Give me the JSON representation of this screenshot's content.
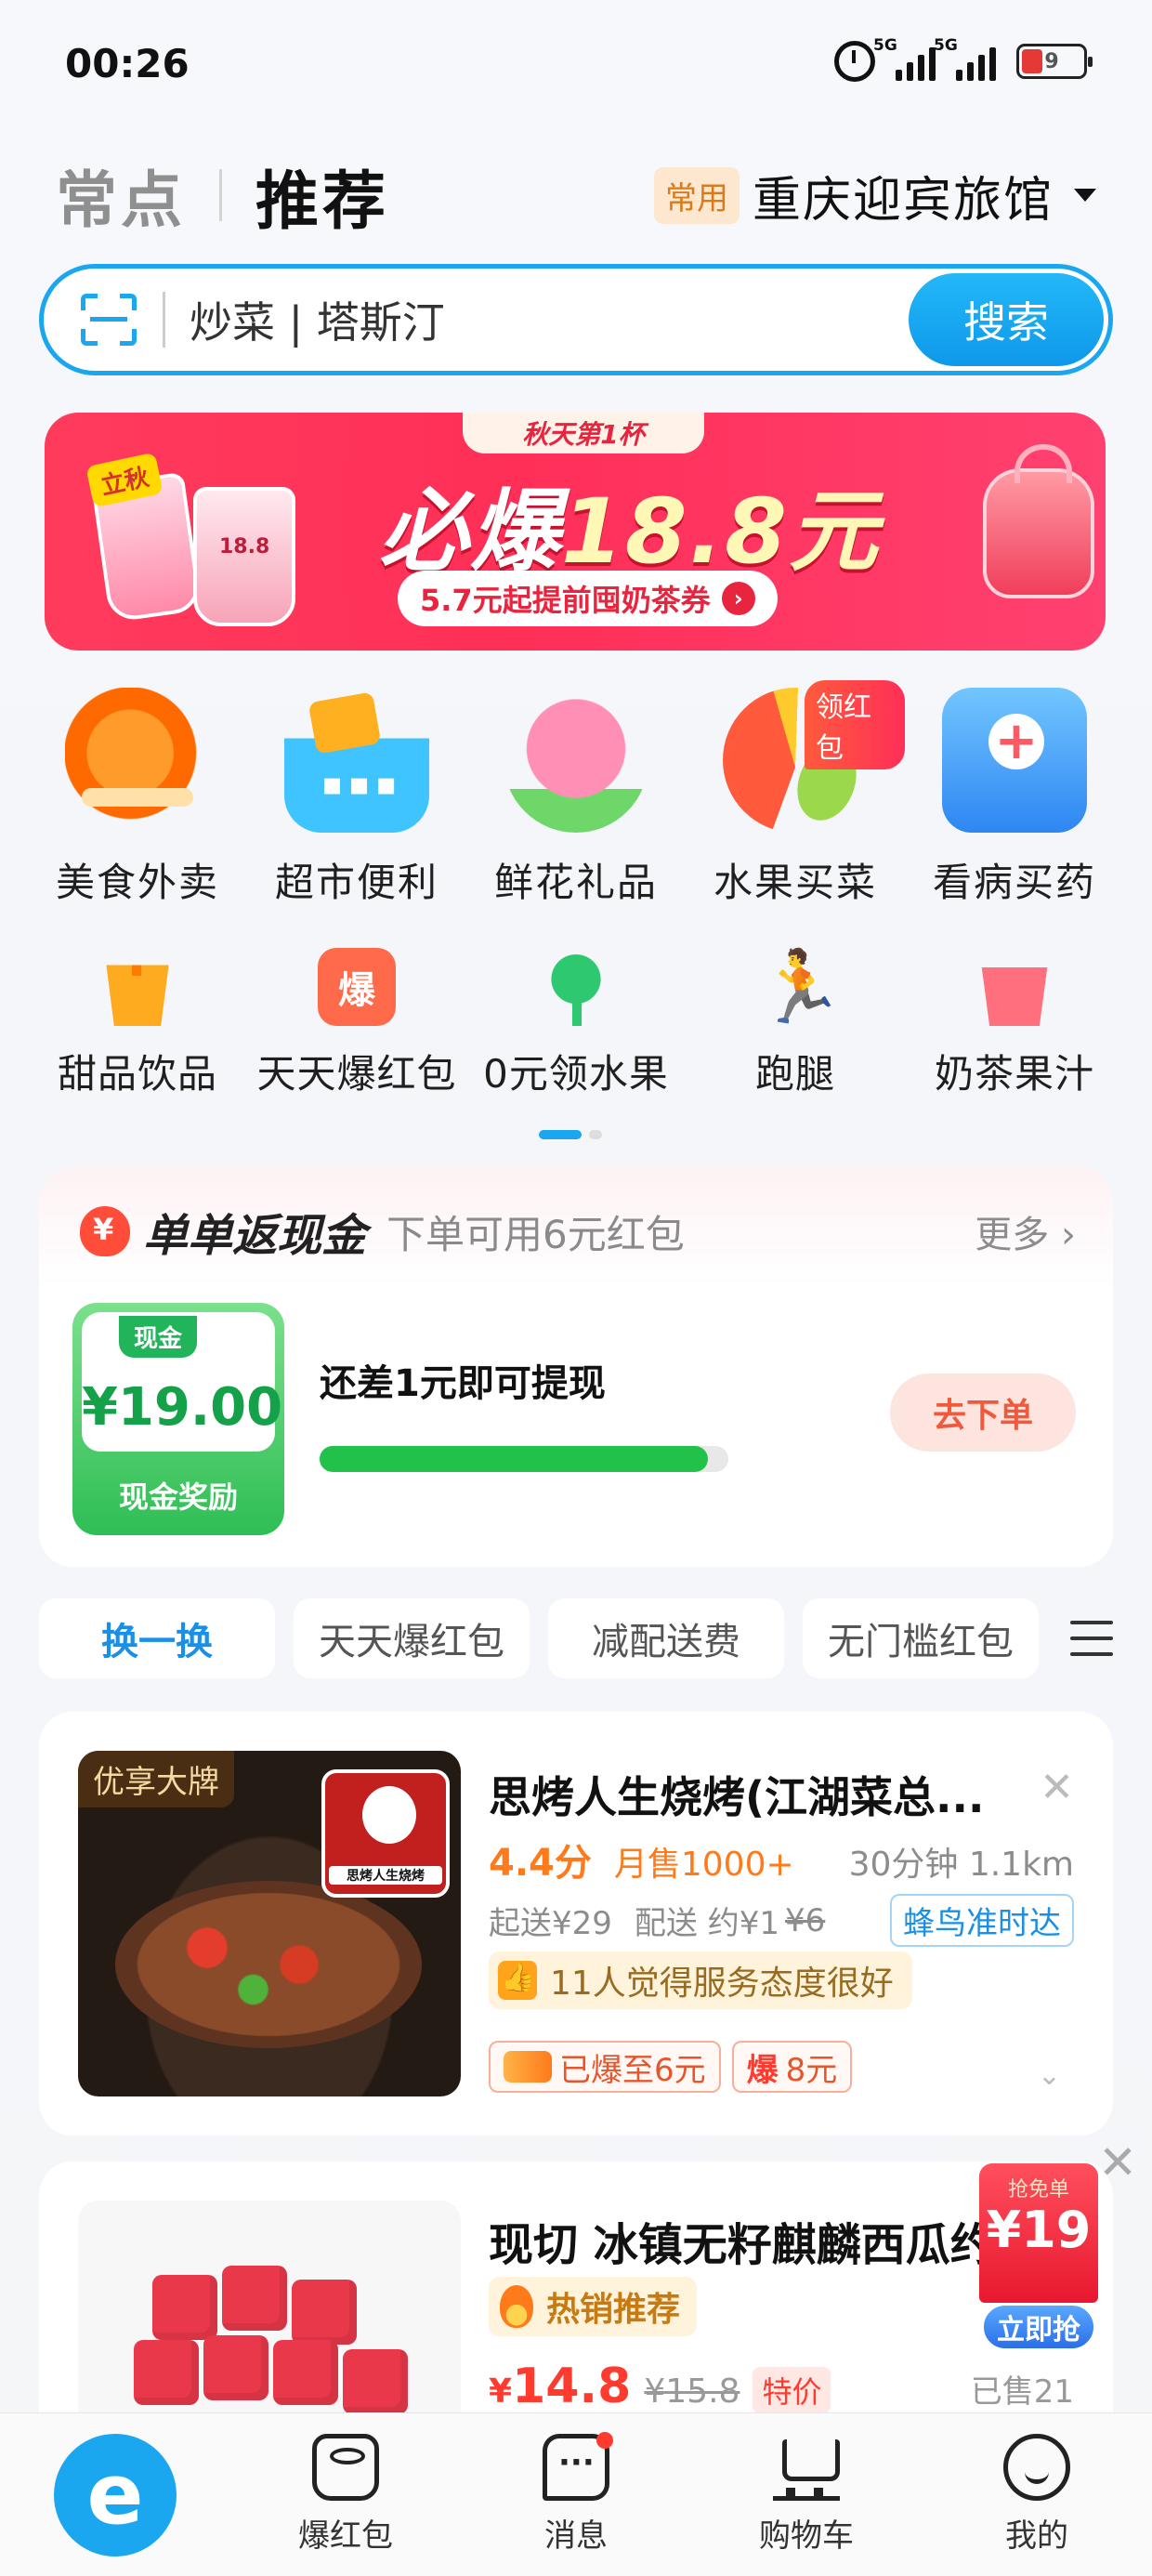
{
  "status_bar": {
    "time": "00:26",
    "network1": "5G",
    "network2": "5G",
    "battery": "9"
  },
  "header": {
    "tab_inactive": "常点",
    "tab_active": "推荐",
    "location_badge": "常用",
    "location_name": "重庆迎宾旅馆"
  },
  "search": {
    "placeholder": "炒菜 | 塔斯汀",
    "button": "搜索"
  },
  "banner": {
    "ribbon": "秋天第1杯",
    "main_prefix": "必爆",
    "main_amount": "18.8元",
    "sub": "5.7元起提前囤奶茶券",
    "cup_price": "18.8",
    "season": "立秋"
  },
  "categories_row1": [
    {
      "label": "美食外卖",
      "icon": "food-delivery-icon"
    },
    {
      "label": "超市便利",
      "icon": "supermarket-basket-icon"
    },
    {
      "label": "鲜花礼品",
      "icon": "rose-flower-icon"
    },
    {
      "label": "水果买菜",
      "icon": "watermelon-icon",
      "badge": "领红包"
    },
    {
      "label": "看病买药",
      "icon": "medicine-box-icon"
    }
  ],
  "categories_row2": [
    {
      "label": "甜品饮品",
      "icon": "dessert-cup-icon"
    },
    {
      "label": "天天爆红包",
      "icon": "red-packet-icon",
      "glyph": "爆"
    },
    {
      "label": "0元领水果",
      "icon": "fruit-tree-icon"
    },
    {
      "label": "跑腿",
      "icon": "runner-icon"
    },
    {
      "label": "奶茶果汁",
      "icon": "juice-cup-icon"
    }
  ],
  "cashback": {
    "title": "单单返现金",
    "desc": "下单可用6元红包",
    "more": "更多 ›",
    "ticket_pill": "现金",
    "amount": "¥19.00",
    "ticket_label": "现金奖励",
    "tip": "还差1元即可提现",
    "progress": 0.95,
    "button": "去下单"
  },
  "filters": [
    "换一换",
    "天天爆红包",
    "减配送费",
    "无门槛红包"
  ],
  "store1": {
    "tag": "优享大牌",
    "logo_text": "思烤人生烧烤",
    "name": "思烤人生烧烤(江湖菜总...",
    "score": "4.4分",
    "sales": "月售1000+",
    "distance": "30分钟 1.1km",
    "min_order": "起送¥29",
    "delivery": "配送 约¥1",
    "delivery_orig": "¥6",
    "fengniao": "蜂鸟准时达",
    "review": "11人觉得服务态度很好",
    "coupon1": "已爆至6元",
    "coupon2_icon": "爆",
    "coupon2": "8元"
  },
  "product": {
    "name": "现切 冰镇无籽麒麟西瓜约",
    "hot": "热销推荐",
    "price_symbol": "¥",
    "price": "14.8",
    "price_orig": "¥15.8",
    "special": "特价",
    "sold": "已售21"
  },
  "float_coupon": {
    "label": "抢免单",
    "amount": "¥19",
    "button": "立即抢"
  },
  "bottom_nav": {
    "home_glyph": "e",
    "items": [
      {
        "label": "爆红包"
      },
      {
        "label": "消息"
      },
      {
        "label": "购物车"
      },
      {
        "label": "我的"
      }
    ]
  },
  "colors": {
    "brand": "#1aa7f0",
    "accent_red": "#ff3b30",
    "green": "#22c24a",
    "orange": "#ff7a1a"
  }
}
